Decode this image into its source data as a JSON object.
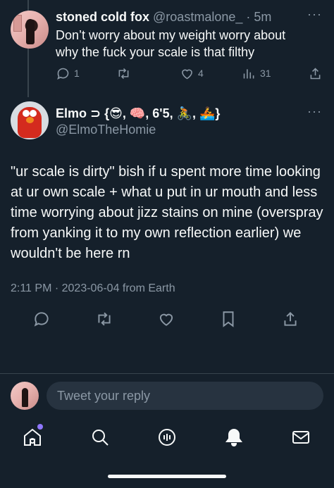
{
  "parent_tweet": {
    "author_name": "stoned cold fox",
    "handle_time": "@roastmalone_ · 5m",
    "text": "Don’t worry about my weight worry about why the fuck your scale is that filthy",
    "more": "···",
    "counts": {
      "replies": "1",
      "retweets": "",
      "likes": "4",
      "views": "31"
    }
  },
  "main_tweet": {
    "author_name": "Elmo ⊃ {😎, 🧠, 6'5, 🚴, 🚣}",
    "handle": "@ElmoTheHomie",
    "more": "···",
    "text": "\"ur scale is dirty\" bish if u spent more time looking at ur own scale + what u put in ur mouth and less time worrying about jizz stains on mine (overspray from yanking it to my own reflection earlier) we wouldn't be here rn",
    "meta": "2:11 PM · 2023-06-04 from Earth"
  },
  "reply": {
    "placeholder": "Tweet your reply"
  },
  "icons": {
    "reply": "reply-icon",
    "retweet": "retweet-icon",
    "like": "heart-icon",
    "views": "views-icon",
    "share": "share-icon",
    "bookmark": "bookmark-icon",
    "home": "home-icon",
    "search": "search-icon",
    "spaces": "spaces-icon",
    "notifications": "bell-icon",
    "messages": "mail-icon"
  },
  "colors": {
    "background": "#15202b",
    "text": "#f7f9f9",
    "muted": "#8b98a5",
    "notification_dot": "#8f76ff"
  }
}
